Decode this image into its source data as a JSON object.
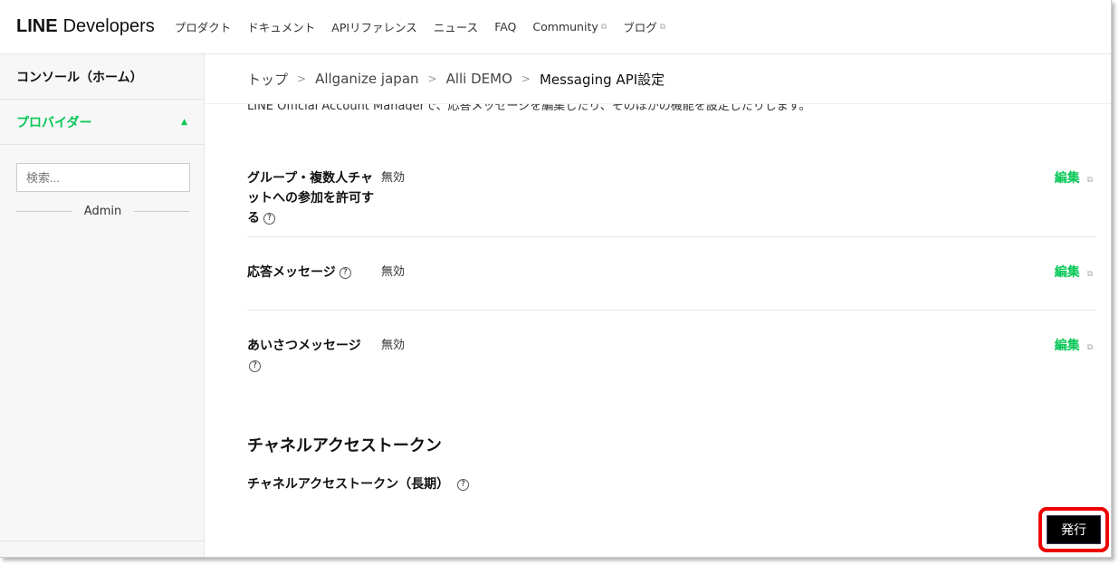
{
  "header": {
    "logo_bold": "LINE",
    "logo_rest": "Developers",
    "nav": [
      "プロダクト",
      "ドキュメント",
      "APIリファレンス",
      "ニュース",
      "FAQ",
      "Community",
      "ブログ"
    ]
  },
  "sidebar": {
    "console": "コンソール（ホーム）",
    "provider": "プロバイダー",
    "search_placeholder": "検索...",
    "admin": "Admin"
  },
  "breadcrumb": [
    "トップ",
    "Allganize japan",
    "Alli DEMO",
    "Messaging API設定"
  ],
  "main": {
    "clipped_text": "LINE Official Account Managerで、応答メッセージを編集したり、そのほかの機能を設定したりします。",
    "settings": [
      {
        "label": "グループ・複数人チャットへの参加を許可する",
        "value": "無効",
        "edit": "編集"
      },
      {
        "label": "応答メッセージ",
        "value": "無効",
        "edit": "編集"
      },
      {
        "label": "あいさつメッセージ",
        "value": "無効",
        "edit": "編集"
      }
    ],
    "token_heading": "チャネルアクセストークン",
    "token_label": "チャネルアクセストークン（長期）",
    "issue_button": "発行"
  },
  "colors": {
    "accent": "#06c755",
    "highlight": "#e00000"
  }
}
